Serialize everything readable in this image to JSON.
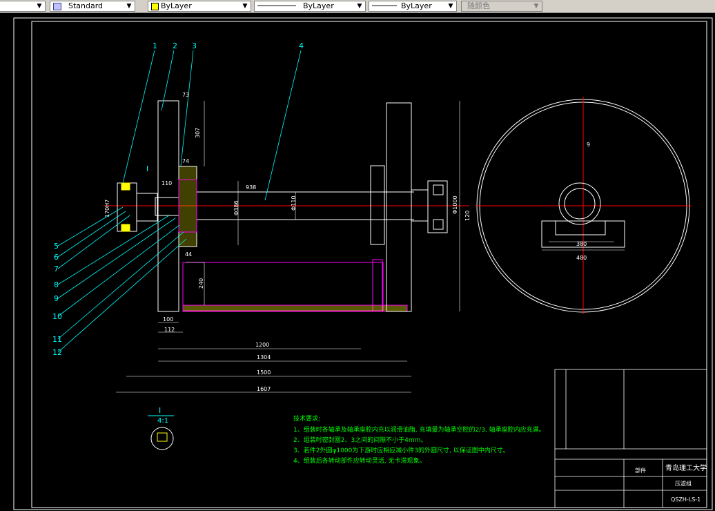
{
  "toolbar": {
    "text_style": "Standard",
    "layer_color": "ByLayer",
    "linetype": "ByLayer",
    "lineweight": "ByLayer",
    "plot_style": "随颜色",
    "swatch_color": "#ffff00"
  },
  "drawing": {
    "part_numbers": [
      "1",
      "2",
      "3",
      "4",
      "5",
      "6",
      "7",
      "8",
      "9",
      "10",
      "11",
      "12"
    ],
    "detail_marker": "I",
    "detail_label": "I",
    "detail_scale": "4:1",
    "dims": {
      "d73": "73",
      "d307": "307",
      "d74": "74",
      "d110": "110",
      "d938": "938",
      "d386": "Φ386",
      "d110b": "Φ110",
      "d1000": "Φ1000",
      "d120": "120",
      "d170": "170H7",
      "d100": "100",
      "d112": "112",
      "d1200": "1200",
      "d1304": "1304",
      "d1500": "1500",
      "d1607": "1607",
      "d240": "240",
      "d44": "44",
      "d9": "9",
      "d380": "380",
      "d480": "480"
    },
    "notes": {
      "title": "技术要求:",
      "items": [
        "1、组装时各轴承及轴承座腔内充以润滑油脂, 充填量为轴承空腔的2/3, 轴承座腔内应充满。",
        "2、组装时密封圈2、3之间的间隙不小于4mm。",
        "3、若件2外圆φ1000为下游时应相应减小件3的外圆尺寸, 以保证图中内尺寸。",
        "4、组装后各转动部件应转动灵活, 无卡滞现象。"
      ]
    },
    "title_block": {
      "school": "青岛理工大学",
      "part_name": "压滤组",
      "material": "部件",
      "drawing_no": "QSZH-LS-1"
    }
  },
  "colors": {
    "cyan": "#00ffff",
    "white": "#ffffff",
    "red": "#ff0000",
    "magenta": "#ff00ff",
    "yellow": "#ffff00",
    "green": "#00ff00"
  }
}
